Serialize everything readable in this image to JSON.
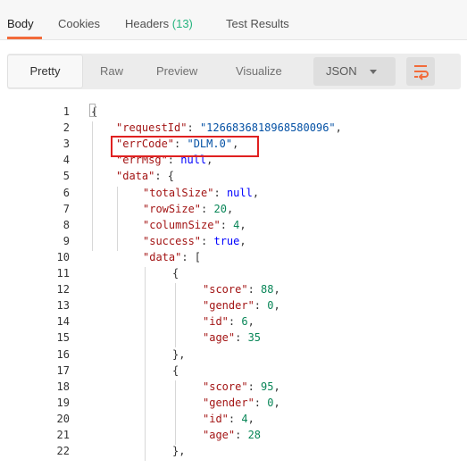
{
  "response_tabs": [
    {
      "label": "Body",
      "active": true
    },
    {
      "label": "Cookies"
    },
    {
      "label": "Headers",
      "count": "(13)"
    },
    {
      "label": "Test Results"
    }
  ],
  "toolbar": {
    "views": [
      "Pretty",
      "Raw",
      "Preview",
      "Visualize"
    ],
    "selected_view": "Pretty",
    "format": "JSON",
    "wrap_icon": "text-wrap-icon"
  },
  "colors": {
    "accent": "#f26b3a",
    "count_green": "#26b47f",
    "key": "#a31515",
    "string": "#0451a5",
    "number": "#098658",
    "literal": "#0000ff",
    "highlight": "#e02020"
  },
  "code": {
    "line_numbers": [
      "1",
      "2",
      "3",
      "4",
      "5",
      "6",
      "7",
      "8",
      "9",
      "10",
      "11",
      "12",
      "13",
      "14",
      "15",
      "16",
      "17",
      "18",
      "19",
      "20",
      "21",
      "22"
    ],
    "lines": [
      [
        {
          "t": "p",
          "v": "{"
        }
      ],
      [
        {
          "t": "k",
          "v": "\"requestId\""
        },
        {
          "t": "p",
          "v": ": "
        },
        {
          "t": "s",
          "v": "\"1266836818968580096\""
        },
        {
          "t": "p",
          "v": ","
        }
      ],
      [
        {
          "t": "k",
          "v": "\"errCode\""
        },
        {
          "t": "p",
          "v": ": "
        },
        {
          "t": "s",
          "v": "\"DLM.0\""
        },
        {
          "t": "p",
          "v": ","
        }
      ],
      [
        {
          "t": "k",
          "v": "\"errMsg\""
        },
        {
          "t": "p",
          "v": ": "
        },
        {
          "t": "lit",
          "v": "null"
        },
        {
          "t": "p",
          "v": ","
        }
      ],
      [
        {
          "t": "k",
          "v": "\"data\""
        },
        {
          "t": "p",
          "v": ": {"
        }
      ],
      [
        {
          "t": "k",
          "v": "\"totalSize\""
        },
        {
          "t": "p",
          "v": ": "
        },
        {
          "t": "lit",
          "v": "null"
        },
        {
          "t": "p",
          "v": ","
        }
      ],
      [
        {
          "t": "k",
          "v": "\"rowSize\""
        },
        {
          "t": "p",
          "v": ": "
        },
        {
          "t": "n",
          "v": "20"
        },
        {
          "t": "p",
          "v": ","
        }
      ],
      [
        {
          "t": "k",
          "v": "\"columnSize\""
        },
        {
          "t": "p",
          "v": ": "
        },
        {
          "t": "n",
          "v": "4"
        },
        {
          "t": "p",
          "v": ","
        }
      ],
      [
        {
          "t": "k",
          "v": "\"success\""
        },
        {
          "t": "p",
          "v": ": "
        },
        {
          "t": "lit",
          "v": "true"
        },
        {
          "t": "p",
          "v": ","
        }
      ],
      [
        {
          "t": "k",
          "v": "\"data\""
        },
        {
          "t": "p",
          "v": ": ["
        }
      ],
      [
        {
          "t": "p",
          "v": "{"
        }
      ],
      [
        {
          "t": "k",
          "v": "\"score\""
        },
        {
          "t": "p",
          "v": ": "
        },
        {
          "t": "n",
          "v": "88"
        },
        {
          "t": "p",
          "v": ","
        }
      ],
      [
        {
          "t": "k",
          "v": "\"gender\""
        },
        {
          "t": "p",
          "v": ": "
        },
        {
          "t": "n",
          "v": "0"
        },
        {
          "t": "p",
          "v": ","
        }
      ],
      [
        {
          "t": "k",
          "v": "\"id\""
        },
        {
          "t": "p",
          "v": ": "
        },
        {
          "t": "n",
          "v": "6"
        },
        {
          "t": "p",
          "v": ","
        }
      ],
      [
        {
          "t": "k",
          "v": "\"age\""
        },
        {
          "t": "p",
          "v": ": "
        },
        {
          "t": "n",
          "v": "35"
        }
      ],
      [
        {
          "t": "p",
          "v": "},"
        }
      ],
      [
        {
          "t": "p",
          "v": "{"
        }
      ],
      [
        {
          "t": "k",
          "v": "\"score\""
        },
        {
          "t": "p",
          "v": ": "
        },
        {
          "t": "n",
          "v": "95"
        },
        {
          "t": "p",
          "v": ","
        }
      ],
      [
        {
          "t": "k",
          "v": "\"gender\""
        },
        {
          "t": "p",
          "v": ": "
        },
        {
          "t": "n",
          "v": "0"
        },
        {
          "t": "p",
          "v": ","
        }
      ],
      [
        {
          "t": "k",
          "v": "\"id\""
        },
        {
          "t": "p",
          "v": ": "
        },
        {
          "t": "n",
          "v": "4"
        },
        {
          "t": "p",
          "v": ","
        }
      ],
      [
        {
          "t": "k",
          "v": "\"age\""
        },
        {
          "t": "p",
          "v": ": "
        },
        {
          "t": "n",
          "v": "28"
        }
      ],
      [
        {
          "t": "p",
          "v": "},"
        }
      ]
    ],
    "highlighted_line": "3"
  }
}
